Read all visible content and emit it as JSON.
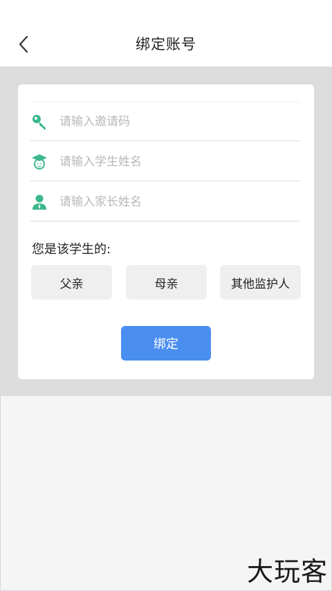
{
  "nav": {
    "title": "绑定账号",
    "back_icon": "chevron-left-icon"
  },
  "form": {
    "invite_code": {
      "placeholder": "请输入邀请码",
      "value": "",
      "icon": "key-icon"
    },
    "student_name": {
      "placeholder": "请输入学生姓名",
      "value": "",
      "icon": "student-icon"
    },
    "parent_name": {
      "placeholder": "请输入家长姓名",
      "value": "",
      "icon": "person-icon"
    }
  },
  "relationship": {
    "question": "您是该学生的:",
    "options": [
      "父亲",
      "母亲",
      "其他监护人"
    ]
  },
  "submit_label": "绑定",
  "watermark": "大玩客",
  "colors": {
    "accent": "#4a8ff0",
    "icon_green": "#3cb88a",
    "band": "#dcdcdc"
  }
}
